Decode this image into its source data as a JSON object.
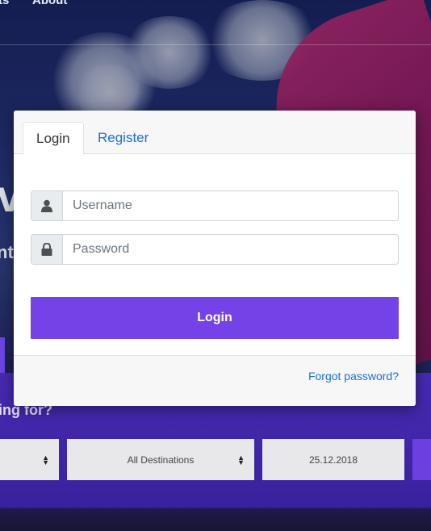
{
  "nav": {
    "items": [
      "ts",
      "About"
    ]
  },
  "hero": {
    "partial_title": "ve",
    "partial_subtitle": "nt"
  },
  "search": {
    "question": "ing for?",
    "destination": "All Destinations",
    "date": "25.12.2018"
  },
  "modal": {
    "tabs": [
      {
        "label": "Login",
        "active": true
      },
      {
        "label": "Register",
        "active": false
      }
    ],
    "username": {
      "placeholder": "Username",
      "icon": "user-icon"
    },
    "password": {
      "placeholder": "Password",
      "icon": "lock-icon"
    },
    "login_label": "Login",
    "forgot_label": "Forgot password?"
  },
  "colors": {
    "accent": "#7442e6",
    "link": "#1b6fe0",
    "band": "#4a2bb8"
  }
}
